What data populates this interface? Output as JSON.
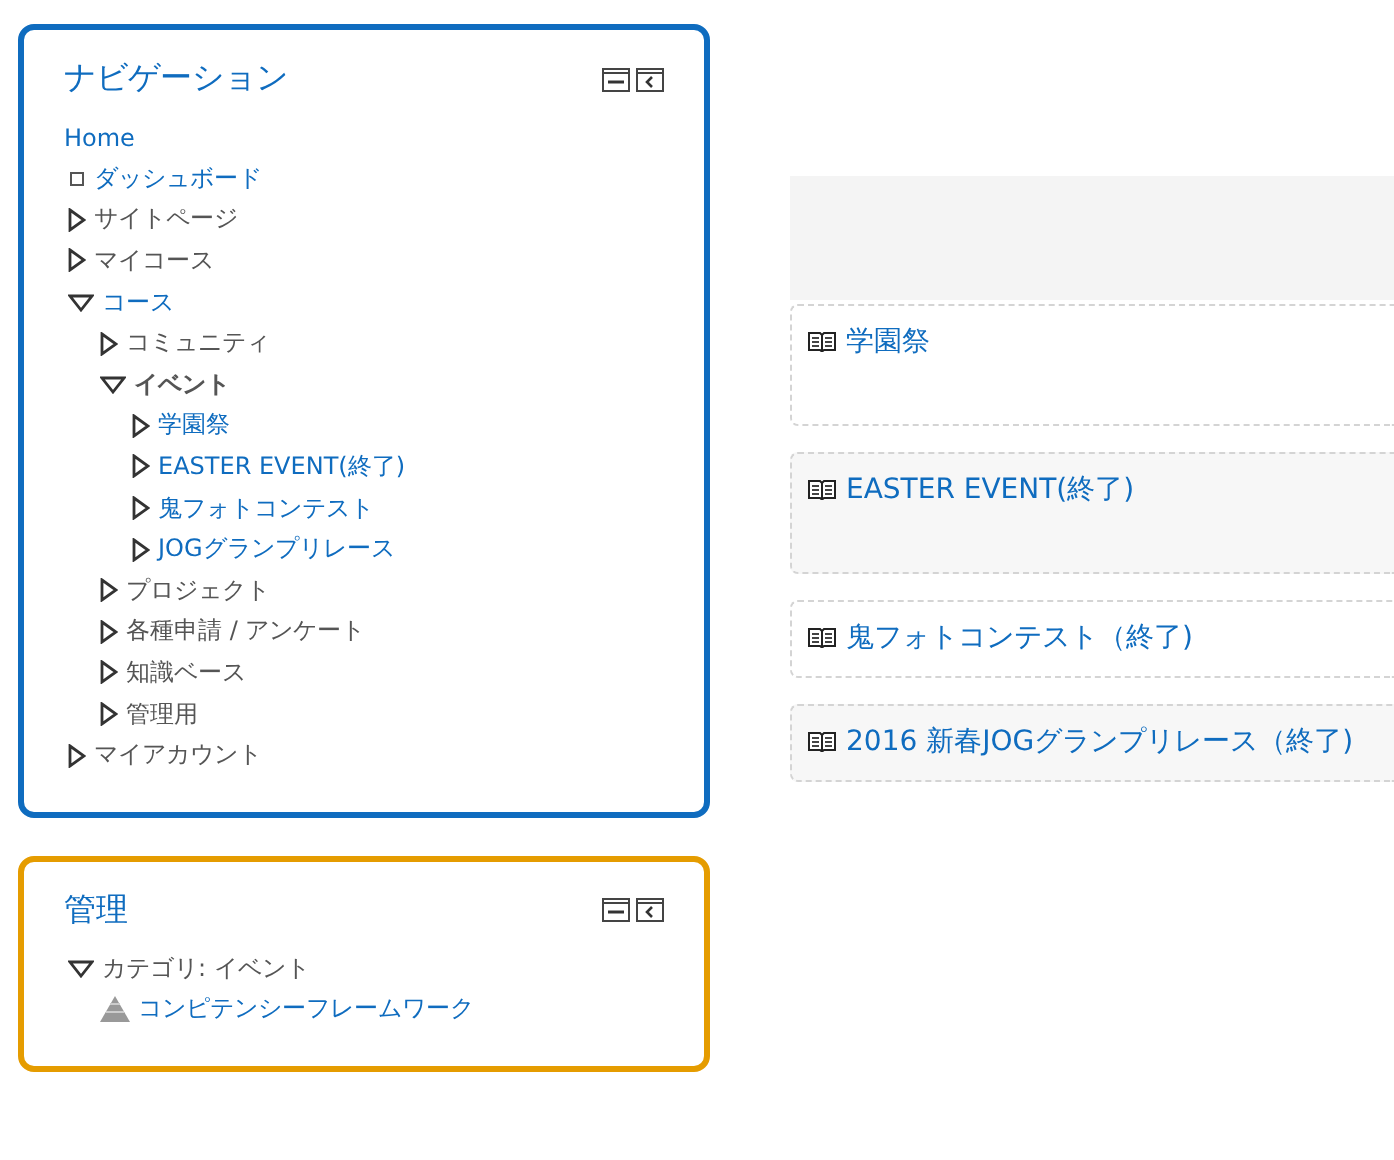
{
  "navigation": {
    "title": "ナビゲーション",
    "home": "Home",
    "items": [
      {
        "label": "ダッシュボード",
        "kind": "leaf",
        "link": true,
        "selected": false
      },
      {
        "label": "サイトページ",
        "kind": "branch",
        "link": false,
        "expanded": false,
        "selected": false
      },
      {
        "label": "マイコース",
        "kind": "branch",
        "link": false,
        "expanded": false,
        "selected": false
      },
      {
        "label": "コース",
        "kind": "branch",
        "link": true,
        "expanded": true,
        "selected": false,
        "children": [
          {
            "label": "コミュニティ",
            "kind": "branch",
            "link": false,
            "expanded": false,
            "selected": false
          },
          {
            "label": "イベント",
            "kind": "branch",
            "link": false,
            "expanded": true,
            "selected": true,
            "children": [
              {
                "label": "学園祭",
                "kind": "branch",
                "link": true,
                "expanded": false,
                "selected": false
              },
              {
                "label": "EASTER EVENT(終了)",
                "kind": "branch",
                "link": true,
                "expanded": false,
                "selected": false
              },
              {
                "label": "鬼フォトコンテスト",
                "kind": "branch",
                "link": true,
                "expanded": false,
                "selected": false
              },
              {
                "label": "JOGグランプリレース",
                "kind": "branch",
                "link": true,
                "expanded": false,
                "selected": false
              }
            ]
          },
          {
            "label": "プロジェクト",
            "kind": "branch",
            "link": false,
            "expanded": false,
            "selected": false
          },
          {
            "label": "各種申請 / アンケート",
            "kind": "branch",
            "link": false,
            "expanded": false,
            "selected": false
          },
          {
            "label": "知識ベース",
            "kind": "branch",
            "link": false,
            "expanded": false,
            "selected": false
          },
          {
            "label": "管理用",
            "kind": "branch",
            "link": false,
            "expanded": false,
            "selected": false
          }
        ]
      },
      {
        "label": "マイアカウント",
        "kind": "branch",
        "link": false,
        "expanded": false,
        "selected": false
      }
    ]
  },
  "administration": {
    "title": "管理",
    "items": [
      {
        "label": "カテゴリ: イベント",
        "kind": "branch",
        "link": false,
        "expanded": true,
        "selected": false,
        "children": [
          {
            "label": "コンピテンシーフレームワーク",
            "kind": "competency",
            "link": true,
            "selected": false
          }
        ]
      }
    ]
  },
  "courses": [
    {
      "title": "学園祭"
    },
    {
      "title": "EASTER EVENT(終了)"
    },
    {
      "title": "鬼フォトコンテスト（終了)"
    },
    {
      "title": "2016 新春JOGグランプリレース（終了)"
    }
  ]
}
